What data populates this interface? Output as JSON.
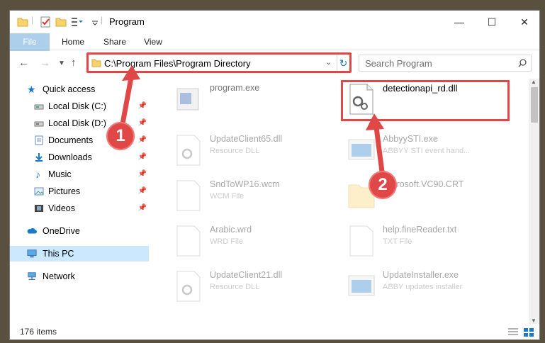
{
  "window": {
    "title": "Program"
  },
  "window_controls": {
    "minimize": "—",
    "maximize": "☐",
    "close": "✕"
  },
  "ribbon": {
    "tabs": [
      "File",
      "Home",
      "Share",
      "View"
    ]
  },
  "address": {
    "path": "C:\\Program Files\\Program Directory"
  },
  "search": {
    "placeholder": "Search Program"
  },
  "navigation": {
    "items": [
      {
        "label": "Quick access",
        "icon": "star-icon",
        "pinned": false
      },
      {
        "label": "Local Disk (C:)",
        "icon": "drive-icon",
        "pinned": true
      },
      {
        "label": "Local Disk (D:)",
        "icon": "drive-icon",
        "pinned": true
      },
      {
        "label": "Documents",
        "icon": "documents-icon",
        "pinned": true
      },
      {
        "label": "Downloads",
        "icon": "downloads-icon",
        "pinned": true
      },
      {
        "label": "Music",
        "icon": "music-icon",
        "pinned": true
      },
      {
        "label": "Pictures",
        "icon": "pictures-icon",
        "pinned": true
      },
      {
        "label": "Videos",
        "icon": "videos-icon",
        "pinned": true
      },
      {
        "label": "OneDrive",
        "icon": "onedrive-icon",
        "pinned": false
      },
      {
        "label": "This PC",
        "icon": "this-pc-icon",
        "pinned": false,
        "selected": true
      },
      {
        "label": "Network",
        "icon": "network-icon",
        "pinned": false
      }
    ]
  },
  "files": [
    {
      "name": "program.exe",
      "type": ""
    },
    {
      "name": "detectionapi_rd.dll",
      "type": ""
    },
    {
      "name": "UpdateClient65.dll",
      "type": "Resource DLL"
    },
    {
      "name": "AbbyySTI.exe",
      "type": "ABBYY STI event hand..."
    },
    {
      "name": "SndToWP16.wcm",
      "type": "WCM File"
    },
    {
      "name": "Microsoft.VC90.CRT",
      "type": ""
    },
    {
      "name": "Arabic.wrd",
      "type": "WRD File"
    },
    {
      "name": "help.fineReader.txt",
      "type": "TXT File"
    },
    {
      "name": "UpdateClient21.dll",
      "type": "Resource DLL"
    },
    {
      "name": "UpdateInstaller.exe",
      "type": "ABBY updates installer"
    }
  ],
  "annotations": [
    {
      "number": "1"
    },
    {
      "number": "2"
    }
  ],
  "status": {
    "item_count": "176 items"
  },
  "colors": {
    "accent": "#1979ca",
    "highlight": "#e04848",
    "selected": "#cce8ff"
  }
}
